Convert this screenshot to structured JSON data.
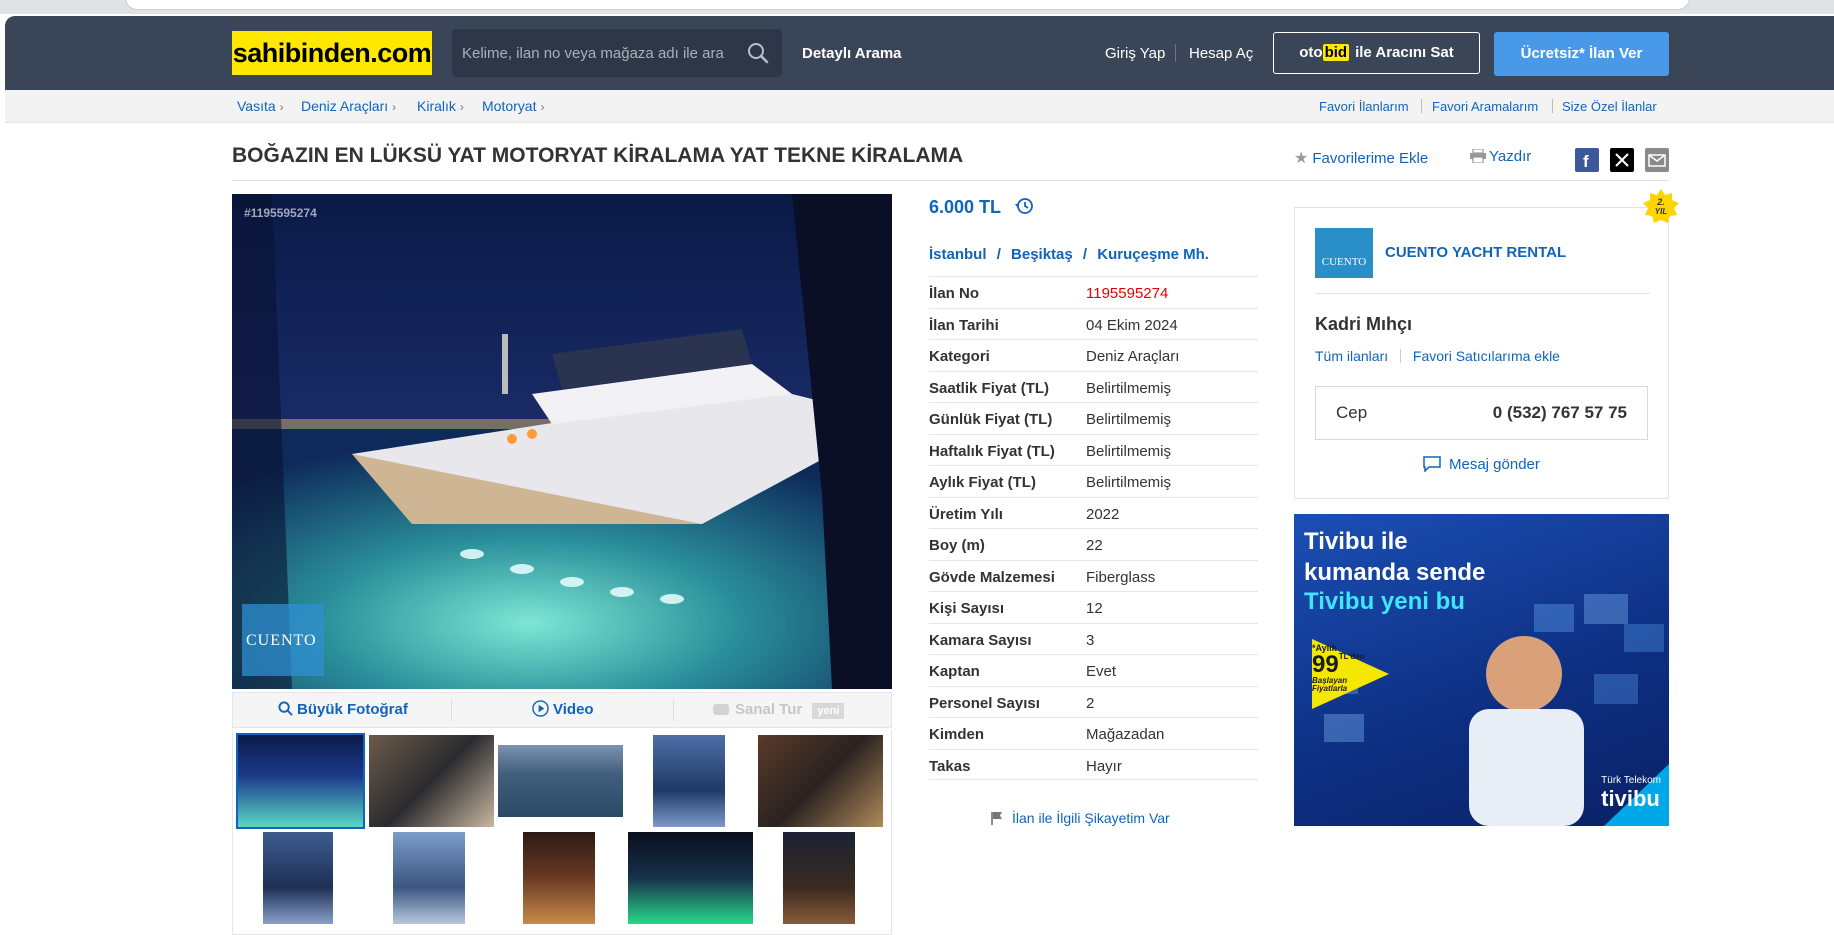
{
  "header": {
    "logo": "sahibinden.com",
    "search_placeholder": "Kelime, ilan no veya mağaza adı ile ara",
    "detailed_search": "Detaylı Arama",
    "login": "Giriş Yap",
    "register": "Hesap Aç",
    "otobid_oto": "oto",
    "otobid_bid": "bid",
    "otobid_rest": "ile Aracını Sat",
    "post_ad": "Ücretsiz* İlan Ver"
  },
  "breadcrumb": [
    "Vasıta",
    "Deniz Araçları",
    "Kiralık",
    "Motoryat"
  ],
  "top_links": [
    "Favori İlanlarım",
    "Favori Aramalarım",
    "Size Özel İlanlar"
  ],
  "listing": {
    "title": "BOĞAZIN EN LÜKSÜ YAT MOTORYAT KİRALAMA YAT TEKNE KİRALAMA",
    "add_favorite": "Favorilerime Ekle",
    "print": "Yazdır",
    "image_id": "#1195595274",
    "image_actions": {
      "big_photo": "Büyük Fotoğraf",
      "video": "Video",
      "virtual_tour": "Sanal Tur",
      "virtual_tour_badge": "yeni"
    },
    "price": "6.000 TL",
    "location": [
      "İstanbul",
      "Beşiktaş",
      "Kuruçeşme Mh."
    ],
    "details": [
      {
        "k": "İlan No",
        "v": "1195595274"
      },
      {
        "k": "İlan Tarihi",
        "v": "04 Ekim 2024"
      },
      {
        "k": "Kategori",
        "v": "Deniz Araçları"
      },
      {
        "k": "Saatlik Fiyat (TL)",
        "v": "Belirtilmemiş"
      },
      {
        "k": "Günlük Fiyat (TL)",
        "v": "Belirtilmemiş"
      },
      {
        "k": "Haftalık Fiyat (TL)",
        "v": "Belirtilmemiş"
      },
      {
        "k": "Aylık Fiyat (TL)",
        "v": "Belirtilmemiş"
      },
      {
        "k": "Üretim Yılı",
        "v": "2022"
      },
      {
        "k": "Boy (m)",
        "v": "22"
      },
      {
        "k": "Gövde Malzemesi",
        "v": "Fiberglass"
      },
      {
        "k": "Kişi Sayısı",
        "v": "12"
      },
      {
        "k": "Kamara Sayısı",
        "v": "3"
      },
      {
        "k": "Kaptan",
        "v": "Evet"
      },
      {
        "k": "Personel Sayısı",
        "v": "2"
      },
      {
        "k": "Kimden",
        "v": "Mağazadan"
      },
      {
        "k": "Takas",
        "v": "Hayır"
      }
    ],
    "complaint": "İlan ile İlgili Şikayetim Var"
  },
  "seller": {
    "store_name": "CUENTO YACHT RENTAL",
    "logo_text": "CUENTO",
    "badge": "2. YIL",
    "person": "Kadri Mıhçı",
    "all_ads": "Tüm ilanları",
    "add_fav_seller": "Favori Satıcılarıma ekle",
    "phone_label": "Cep",
    "phone": "0 (532) 767 57 75",
    "message": "Mesaj gönder"
  },
  "ad": {
    "line1": "Tivibu ile",
    "line2": "kumanda sende",
    "line3": "Tivibu yeni bu",
    "price_small": "*Aylık",
    "price": "99",
    "price_unit": "TL'den",
    "price_note1": "Başlayan",
    "price_note2": "Fiyatlarla",
    "brand_top": "Türk Telekom",
    "brand": "tivibu"
  },
  "colors": {
    "header_bg": "#3b4558",
    "logo_yellow": "#ffe800",
    "link_blue": "#1064bc",
    "cta_blue": "#489ae9",
    "id_red": "#e60000"
  }
}
